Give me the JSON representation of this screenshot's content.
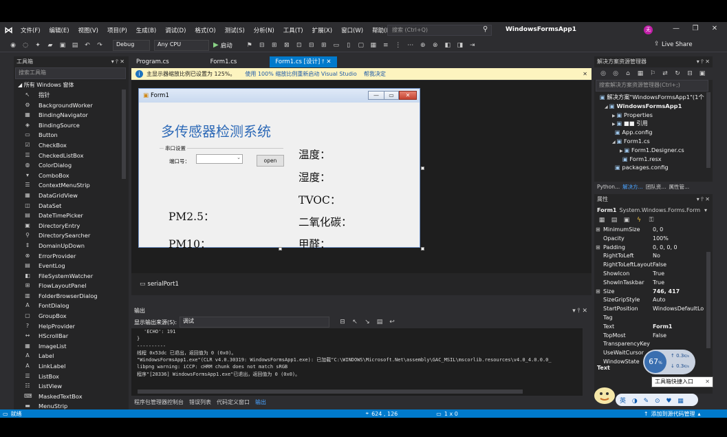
{
  "app": {
    "title": "WindowsFormsApp1",
    "quick_launch_placeholder": "搜索 (Ctrl+Q)",
    "user_avatar": "无",
    "live_share": "Live Share"
  },
  "menu": [
    "文件(F)",
    "编辑(E)",
    "视图(V)",
    "项目(P)",
    "生成(B)",
    "调试(D)",
    "格式(O)",
    "测试(S)",
    "分析(N)",
    "工具(T)",
    "扩展(X)",
    "窗口(W)",
    "帮助(H)"
  ],
  "toolbar": {
    "config": "Debug",
    "platform": "Any CPU",
    "start_label": "启动"
  },
  "toolbox": {
    "title": "工具箱",
    "search_placeholder": "搜索工具箱",
    "group": "所有 Windows 窗体",
    "items": [
      "指针",
      "BackgroundWorker",
      "BindingNavigator",
      "BindingSource",
      "Button",
      "CheckBox",
      "CheckedListBox",
      "ColorDialog",
      "ComboBox",
      "ContextMenuStrip",
      "DataGridView",
      "DataSet",
      "DateTimePicker",
      "DirectoryEntry",
      "DirectorySearcher",
      "DomainUpDown",
      "ErrorProvider",
      "EventLog",
      "FileSystemWatcher",
      "FlowLayoutPanel",
      "FolderBrowserDialog",
      "FontDialog",
      "GroupBox",
      "HelpProvider",
      "HScrollBar",
      "ImageList",
      "Label",
      "LinkLabel",
      "ListBox",
      "ListView",
      "MaskedTextBox",
      "MenuStrip"
    ]
  },
  "tabs": [
    {
      "label": "Program.cs",
      "active": false
    },
    {
      "label": "Form1.cs",
      "active": false
    },
    {
      "label": "Form1.cs [设计]",
      "active": true
    }
  ],
  "infobar": {
    "message": "主显示器缩放比例已设置为 125%。",
    "link1": "使用 100% 缩放比例重新启动 Visual Studio",
    "link2": "帮我决定"
  },
  "form": {
    "title": "Form1",
    "heading": "多传感器检测系统",
    "group_label": "串口设置",
    "port_label": "端口号：",
    "open_button": "open",
    "labels_right": [
      "温度：",
      "湿度：",
      "TVOC：",
      "二氧化碳：",
      "甲醛："
    ],
    "labels_left": [
      "PM2.5：",
      "PM10："
    ]
  },
  "component_tray": {
    "item": "serialPort1"
  },
  "output": {
    "title": "输出",
    "source_label": "显示输出来源(S):",
    "source_value": "调试",
    "lines": [
      "'ECHO': 191",
      "}",
      "----------",
      "线程 0x53dc 已退出，返回值为 0 (0x0)。",
      "\"WindowsFormsApp1.exe\"(CLR v4.0.30319: WindowsFormsApp1.exe): 已加载\"C:\\WINDOWS\\Microsoft.Net\\assembly\\GAC_MSIL\\mscorlib.resources\\v4.0_4.0.0.0_",
      "libpng warning: iCCP: cHRM chunk does not match sRGB",
      "程序\"[28336] WindowsFormsApp1.exe\"已退出，返回值为 0 (0x0)。"
    ],
    "tabs": [
      "程序包管理器控制台",
      "错误列表",
      "代码定义窗口",
      "输出"
    ]
  },
  "solution": {
    "title": "解决方案资源管理器",
    "search_placeholder": "搜索解决方案资源管理器(Ctrl+;)",
    "items": [
      {
        "label": "解决方案\"WindowsFormsApp1\"(1个",
        "indent": 0,
        "arrow": ""
      },
      {
        "label": "WindowsFormsApp1",
        "indent": 1,
        "arrow": "◢",
        "bold": true
      },
      {
        "label": "Properties",
        "indent": 2,
        "arrow": "▶"
      },
      {
        "label": "■■ 引用",
        "indent": 2,
        "arrow": "▶"
      },
      {
        "label": "App.config",
        "indent": 2,
        "arrow": ""
      },
      {
        "label": "Form1.cs",
        "indent": 2,
        "arrow": "◢"
      },
      {
        "label": "Form1.Designer.cs",
        "indent": 3,
        "arrow": "▶"
      },
      {
        "label": "Form1.resx",
        "indent": 3,
        "arrow": ""
      },
      {
        "label": "packages.config",
        "indent": 2,
        "arrow": ""
      }
    ],
    "tabs": [
      "Python...",
      "解决方...",
      "团队资...",
      "属性管..."
    ]
  },
  "properties": {
    "title": "属性",
    "object": "Form1",
    "object_type": "System.Windows.Forms.Form",
    "rows": [
      {
        "name": "MinimumSize",
        "value": "0, 0",
        "expand": "⊞"
      },
      {
        "name": "Opacity",
        "value": "100%",
        "expand": ""
      },
      {
        "name": "Padding",
        "value": "0, 0, 0, 0",
        "expand": "⊞"
      },
      {
        "name": "RightToLeft",
        "value": "No",
        "expand": ""
      },
      {
        "name": "RightToLeftLayout",
        "value": "False",
        "expand": ""
      },
      {
        "name": "ShowIcon",
        "value": "True",
        "expand": ""
      },
      {
        "name": "ShowInTaskbar",
        "value": "True",
        "expand": ""
      },
      {
        "name": "Size",
        "value": "746, 417",
        "expand": "⊞",
        "bold": true
      },
      {
        "name": "SizeGripStyle",
        "value": "Auto",
        "expand": ""
      },
      {
        "name": "StartPosition",
        "value": "WindowsDefaultLo",
        "expand": ""
      },
      {
        "name": "Tag",
        "value": "",
        "expand": ""
      },
      {
        "name": "Text",
        "value": "Form1",
        "expand": "",
        "bold": true
      },
      {
        "name": "TopMost",
        "value": "False",
        "expand": ""
      },
      {
        "name": "TransparencyKey",
        "value": "",
        "expand": ""
      },
      {
        "name": "UseWaitCursor",
        "value": "",
        "expand": ""
      },
      {
        "name": "WindowState",
        "value": "",
        "expand": ""
      }
    ],
    "desc_title": "Text"
  },
  "overlay": {
    "gauge_percent": "67",
    "gauge_unit": "%",
    "up_speed": "0.3",
    "up_unit": "K/s",
    "down_speed": "0.3",
    "down_unit": "K/s",
    "tooltip": "工具箱快捷入口",
    "floatbar": "英 ◑ ✎ ⊙ ♥ ▦"
  },
  "status": {
    "ready": "就绪",
    "position": "624 , 126",
    "size": "1 x 0",
    "source_control": "添加到源代码管理"
  }
}
